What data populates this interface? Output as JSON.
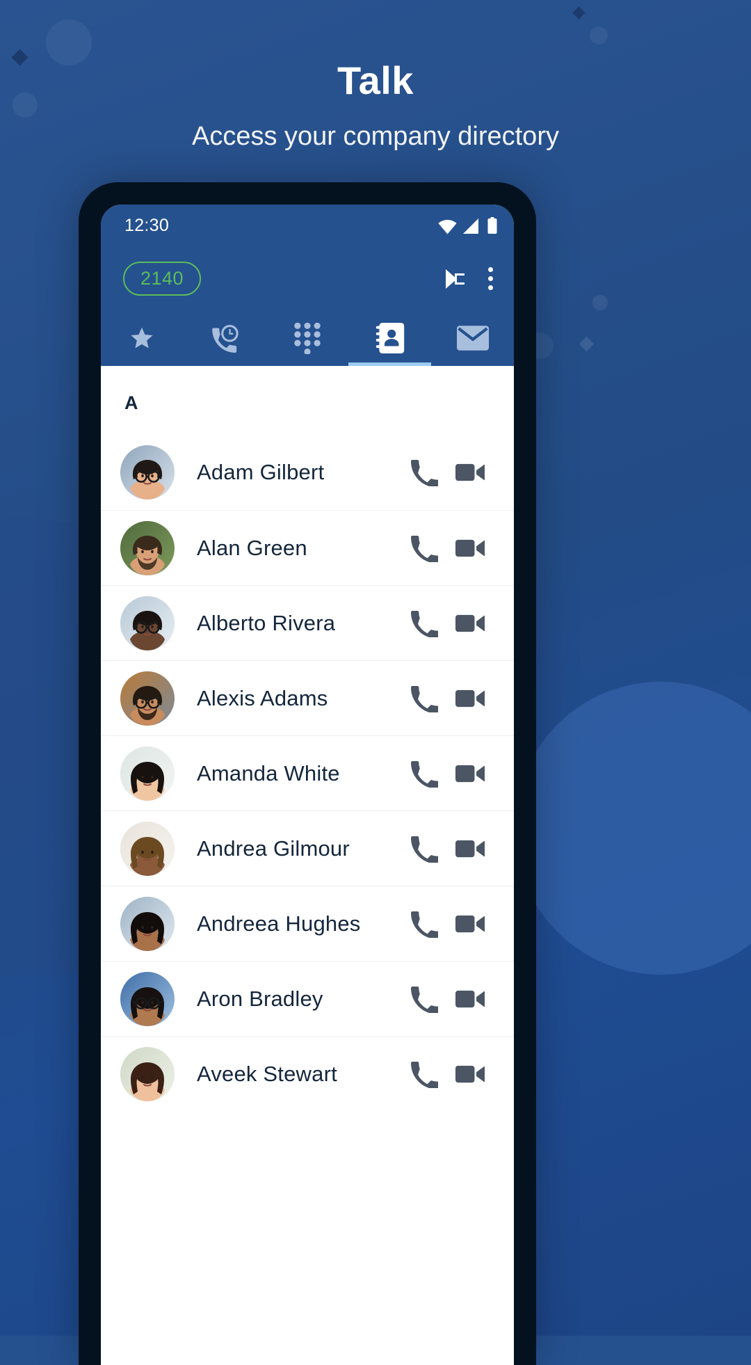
{
  "hero": {
    "title": "Talk",
    "subtitle": "Access your company directory"
  },
  "phone": {
    "status_bar": {
      "time": "12:30",
      "icons": [
        "wifi-icon",
        "cellular-signal-icon",
        "battery-icon"
      ]
    },
    "app_bar": {
      "extension_badge": "2140",
      "extension_badge_color": "#5bbd5b",
      "transfer_icon": "call-transfer-icon",
      "overflow_icon": "more-vertical-icon"
    },
    "tabs": [
      {
        "name": "favorites",
        "icon": "star-icon",
        "active": false
      },
      {
        "name": "recents",
        "icon": "recent-calls-icon",
        "active": false
      },
      {
        "name": "dialpad",
        "icon": "dialpad-icon",
        "active": false
      },
      {
        "name": "contacts",
        "icon": "contacts-book-icon",
        "active": true
      },
      {
        "name": "voicemail",
        "icon": "envelope-icon",
        "active": false
      }
    ],
    "contacts": {
      "section_label": "A",
      "call_icon": "phone-icon",
      "video_icon": "video-camera-icon",
      "items": [
        {
          "name": "Adam Gilbert",
          "skin": "#e8b089",
          "hair": "#201814",
          "bg1": "#8fa6bd",
          "bg2": "#d9e2ea",
          "glasses": true,
          "hairstyle": "short"
        },
        {
          "name": "Alan Green",
          "skin": "#d9a077",
          "hair": "#3a2a1c",
          "bg1": "#4f6b3c",
          "bg2": "#7f9a5c",
          "glasses": false,
          "hairstyle": "beard"
        },
        {
          "name": "Alberto Rivera",
          "skin": "#6b4631",
          "hair": "#1a1210",
          "bg1": "#b9c9d6",
          "bg2": "#e6eef3",
          "glasses": true,
          "hairstyle": "short"
        },
        {
          "name": "Alexis Adams",
          "skin": "#c88b5e",
          "hair": "#241a12",
          "bg1": "#b97a3a",
          "bg2": "#7e8b96",
          "glasses": true,
          "hairstyle": "beard"
        },
        {
          "name": "Amanda White",
          "skin": "#f0c6a2",
          "hair": "#17120f",
          "bg1": "#dde6e4",
          "bg2": "#f2f4f2",
          "glasses": false,
          "hairstyle": "long"
        },
        {
          "name": "Andrea Gilmour",
          "skin": "#8a5a3b",
          "hair": "#6b4a22",
          "bg1": "#e8e3dc",
          "bg2": "#f6f3ee",
          "glasses": false,
          "hairstyle": "curly"
        },
        {
          "name": "Andreea Hughes",
          "skin": "#a9714a",
          "hair": "#120d0b",
          "bg1": "#9fb4c6",
          "bg2": "#dfe8ef",
          "glasses": false,
          "hairstyle": "long"
        },
        {
          "name": "Aron Bradley",
          "skin": "#b07a50",
          "hair": "#171010",
          "bg1": "#3f6ea8",
          "bg2": "#9fc0e0",
          "glasses": true,
          "hairstyle": "curly"
        },
        {
          "name": "Aveek Stewart",
          "skin": "#eec09c",
          "hair": "#3a2015",
          "bg1": "#cfd8c6",
          "bg2": "#eef1e8",
          "glasses": false,
          "hairstyle": "long"
        }
      ]
    }
  },
  "colors": {
    "brand_blue": "#25518f",
    "page_bg": "#234c86",
    "accent_green": "#5bbd5b",
    "tab_indicator": "#9ecbf2",
    "inactive_tab": "#a8bedd",
    "text_dark": "#14263c"
  }
}
